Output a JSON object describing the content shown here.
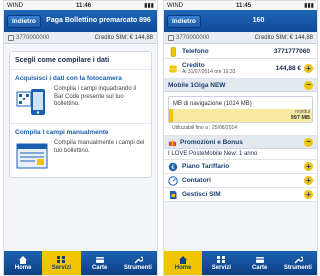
{
  "left": {
    "status": {
      "carrier": "WIND",
      "time": "11:46"
    },
    "nav": {
      "back": "Indietro",
      "title": "Paga Bollettino premarcato 896"
    },
    "subbar": {
      "number": "3770000000",
      "credit": "Credito SIM: € 144,88"
    },
    "card": {
      "heading": "Scegli come compilare i dati",
      "options": [
        {
          "title": "Acquisisci i dati con la fotocamera",
          "text": "Compila i campi inquadrando il Bar Code presente sul tuo bollettino."
        },
        {
          "title": "Compila i campi manualmente",
          "text": "Compila manualmente i campi del tuo bollettino."
        }
      ]
    },
    "tabs": [
      {
        "label": "Home",
        "icon": "home-icon"
      },
      {
        "label": "Servizi",
        "icon": "services-icon"
      },
      {
        "label": "Carte",
        "icon": "cards-icon"
      },
      {
        "label": "Strumenti",
        "icon": "tools-icon"
      }
    ],
    "active_tab": "Servizi"
  },
  "right": {
    "status": {
      "carrier": "WIND",
      "time": "11:45"
    },
    "nav": {
      "back": "Indietro",
      "title": "160"
    },
    "subbar": {
      "number": "3770000000",
      "credit": "Credito SIM: € 144,88"
    },
    "telefono": {
      "label": "Telefono",
      "value": "3771777060"
    },
    "credito": {
      "label": "Credito",
      "sub": "Al 31/07/2014 ore 10:33",
      "value": "144,88 €"
    },
    "plan": {
      "title": "Mobile 1Giga NEW",
      "traffic_label": "MB di navigazione (1024 MB)",
      "remaining_label": "residui",
      "remaining_value": "997 MB",
      "used_fraction": 0.03,
      "valid_until": "Utilizzabili fino a : 25/08/2014"
    },
    "promo": {
      "title": "Promozioni e Bonus",
      "item": "I LOVE PosteMobile New: 1 anno"
    },
    "rows": [
      {
        "label": "Piano Tariffario",
        "icon": "tariff-icon"
      },
      {
        "label": "Contatori",
        "icon": "counters-icon"
      },
      {
        "label": "Gestisci SIM",
        "icon": "sim-manage-icon"
      }
    ],
    "tabs": [
      {
        "label": "Home",
        "icon": "home-icon"
      },
      {
        "label": "Servizi",
        "icon": "services-icon"
      },
      {
        "label": "Carte",
        "icon": "cards-icon"
      },
      {
        "label": "Strumenti",
        "icon": "tools-icon"
      }
    ],
    "active_tab": "Home",
    "colors": {
      "brand_blue": "#0f4a96",
      "accent_yellow": "#f0c400"
    }
  }
}
